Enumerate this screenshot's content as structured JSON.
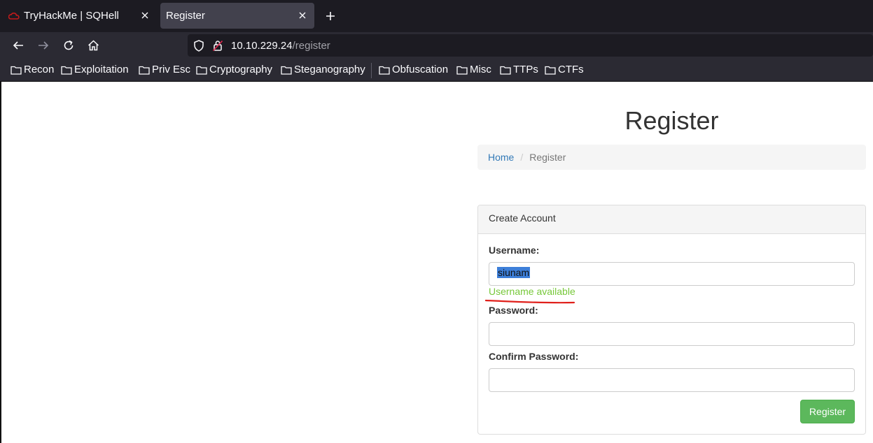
{
  "browser": {
    "tabs": [
      {
        "label": "TryHackMe | SQHell",
        "active": false
      },
      {
        "label": "Register",
        "active": true
      }
    ],
    "url_host": "10.10.229.24",
    "url_path": "/register",
    "bookmarks": [
      "Recon",
      "Exploitation",
      "Priv Esc",
      "Cryptography",
      "Steganography",
      "Obfuscation",
      "Misc",
      "TTPs",
      "CTFs"
    ]
  },
  "page": {
    "title": "Register",
    "breadcrumb": {
      "home": "Home",
      "separator": "/",
      "current": "Register"
    },
    "panel": {
      "heading": "Create Account",
      "username_label": "Username:",
      "username_value": "siunam",
      "username_status": "Username available",
      "password_label": "Password:",
      "confirm_label": "Confirm Password:",
      "submit_label": "Register"
    }
  },
  "colors": {
    "success_text": "#77c83a",
    "button": "#5cb85c",
    "link": "#337ab7",
    "annotation": "#e0201b"
  }
}
